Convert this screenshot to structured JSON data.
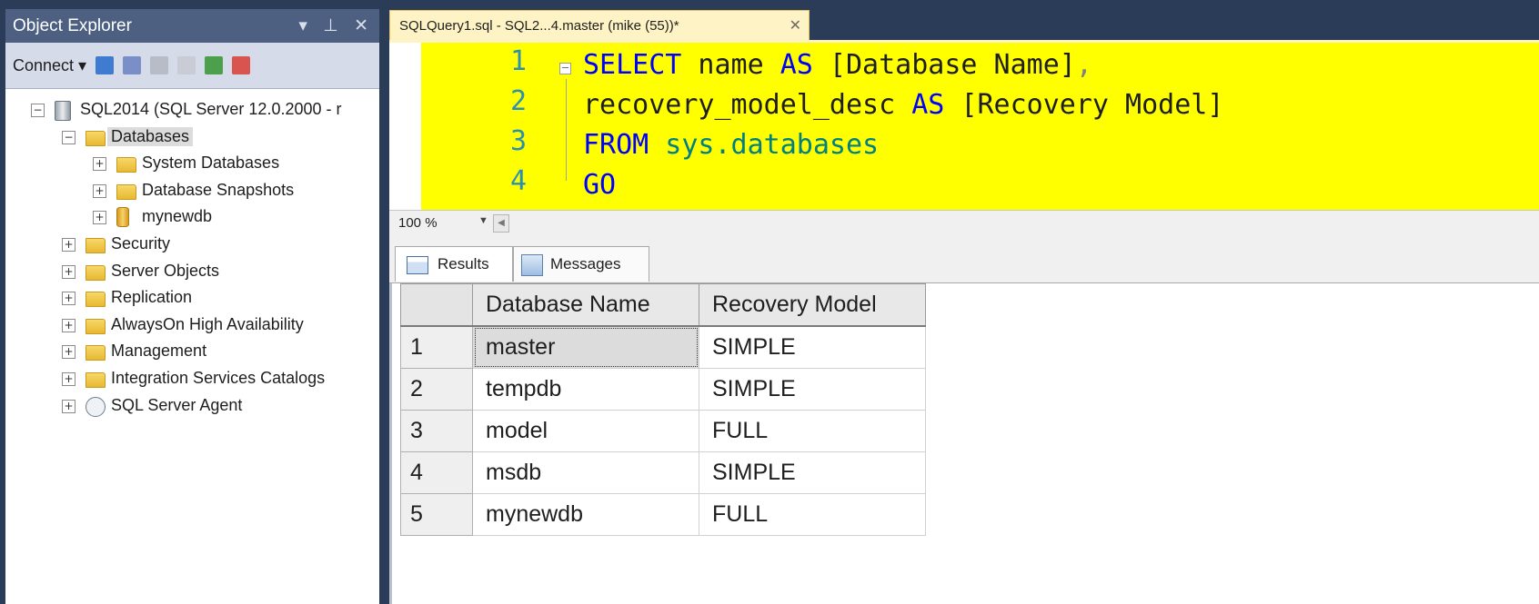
{
  "object_explorer": {
    "title": "Object Explorer",
    "controls": "▾ ⊥ ✕",
    "toolbar": {
      "connect_label": "Connect ▾"
    },
    "tree": [
      {
        "label": "SQL2014 (SQL Server 12.0.2000 - r",
        "level": 0,
        "expander": "−",
        "icon": "server-icon"
      },
      {
        "label": "Databases",
        "level": 1,
        "expander": "−",
        "icon": "folder-icon",
        "selected": true
      },
      {
        "label": "System Databases",
        "level": 2,
        "expander": "+",
        "icon": "folder-icon"
      },
      {
        "label": "Database Snapshots",
        "level": 2,
        "expander": "+",
        "icon": "folder-icon"
      },
      {
        "label": "mynewdb",
        "level": 2,
        "expander": "+",
        "icon": "database-icon"
      },
      {
        "label": "Security",
        "level": 1,
        "expander": "+",
        "icon": "folder-icon"
      },
      {
        "label": "Server Objects",
        "level": 1,
        "expander": "+",
        "icon": "folder-icon"
      },
      {
        "label": "Replication",
        "level": 1,
        "expander": "+",
        "icon": "folder-icon"
      },
      {
        "label": "AlwaysOn High Availability",
        "level": 1,
        "expander": "+",
        "icon": "folder-icon"
      },
      {
        "label": "Management",
        "level": 1,
        "expander": "+",
        "icon": "folder-icon"
      },
      {
        "label": "Integration Services Catalogs",
        "level": 1,
        "expander": "+",
        "icon": "folder-icon"
      },
      {
        "label": "SQL Server Agent",
        "level": 1,
        "expander": "+",
        "icon": "agent-icon"
      }
    ]
  },
  "editor_tab": {
    "title": "SQLQuery1.sql - SQL2...4.master (mike (55))*",
    "close": "✕"
  },
  "editor": {
    "line_numbers": [
      "1",
      "2",
      "3",
      "4"
    ],
    "lines": {
      "l1_kw1": "SELECT",
      "l1_name": " name ",
      "l1_kw2": "AS",
      "l1_bracket": " [Database Name]",
      "l1_comma": ",",
      "l2_name": "recovery_model_desc ",
      "l2_kw": "AS",
      "l2_bracket": " [Recovery Model]",
      "l3_kw": "FROM",
      "l3_sys": " sys.databases",
      "l4_kw": "GO"
    },
    "highlight_color": "#ffff00"
  },
  "zoom": {
    "value": "100 %"
  },
  "results_tabs": {
    "results": "Results",
    "messages": "Messages"
  },
  "grid": {
    "columns": [
      "Database Name",
      "Recovery Model"
    ],
    "rows": [
      {
        "n": "1",
        "name": "master",
        "model": "SIMPLE"
      },
      {
        "n": "2",
        "name": "tempdb",
        "model": "SIMPLE"
      },
      {
        "n": "3",
        "name": "model",
        "model": "FULL"
      },
      {
        "n": "4",
        "name": "msdb",
        "model": "SIMPLE"
      },
      {
        "n": "5",
        "name": "mynewdb",
        "model": "FULL"
      }
    ]
  }
}
